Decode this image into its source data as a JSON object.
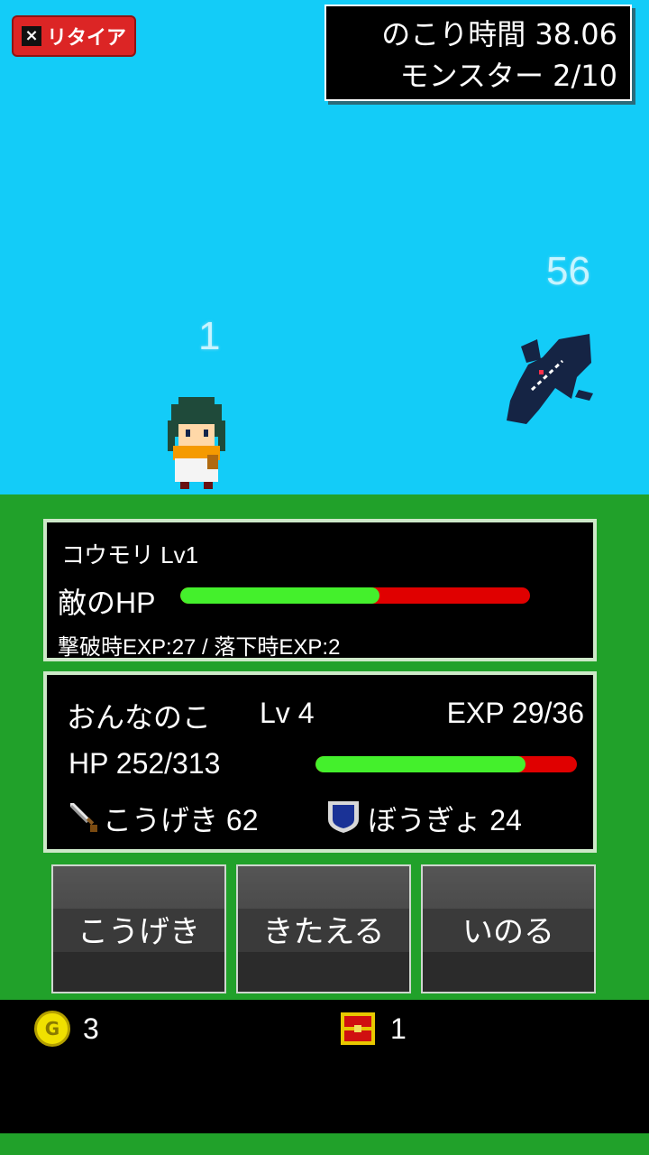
{
  "top": {
    "retire_label": "リタイア",
    "retire_icon": "×",
    "time_label": "のこり時間 38.06",
    "monster_label": "モンスター 2/10"
  },
  "battle": {
    "player_damage": "1",
    "enemy_damage": "56"
  },
  "enemy": {
    "name": "コウモリ Lv1",
    "hp_label": "敵のHP",
    "hp_ratio": 0.57,
    "exp_info": "撃破時EXP:27 / 落下時EXP:2"
  },
  "player": {
    "name": "おんなのこ",
    "level": "Lv 4",
    "exp": "EXP 29/36",
    "hp": "HP 252/313",
    "hp_ratio": 0.805,
    "attack": "こうげき 62",
    "defense": "ぼうぎょ 24"
  },
  "commands": {
    "attack": "こうげき",
    "train": "きたえる",
    "pray": "いのる"
  },
  "inventory": {
    "gold": "3",
    "chests": "1"
  },
  "colors": {
    "sky": "#13ccf8",
    "ground": "#21a12a",
    "hp_fill": "#44f02c",
    "hp_empty": "#e00000"
  }
}
